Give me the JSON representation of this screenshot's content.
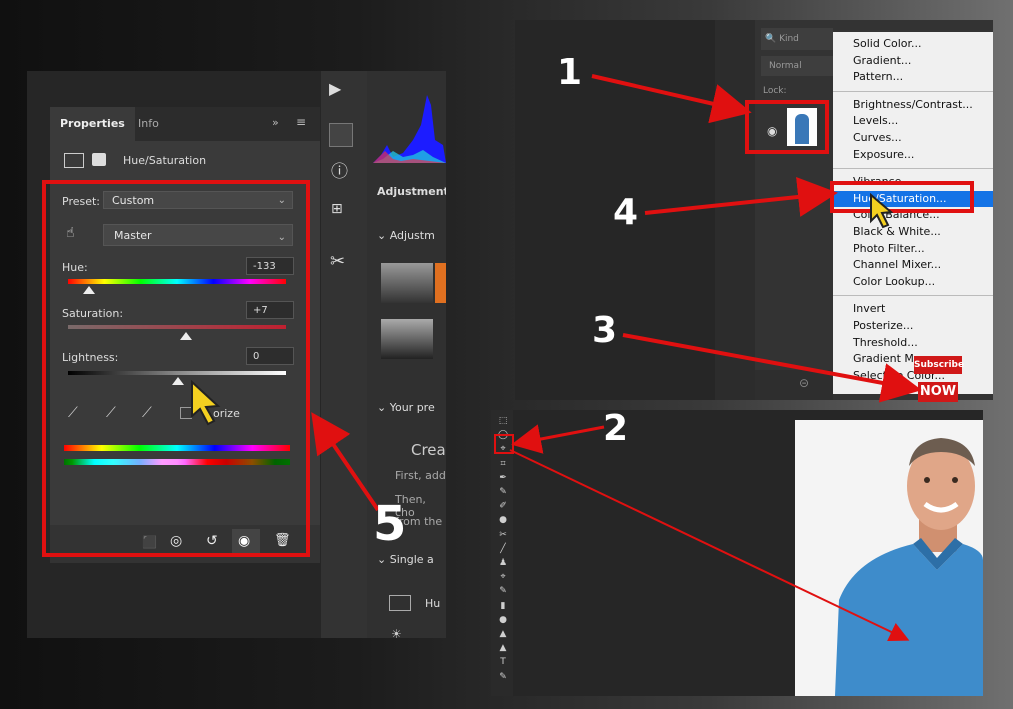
{
  "properties_panel": {
    "tabs": [
      "Properties",
      "Info"
    ],
    "title": "Hue/Saturation",
    "preset_label": "Preset:",
    "preset_value": "Custom",
    "channel_value": "Master",
    "hue_label": "Hue:",
    "hue_value": "-133",
    "saturation_label": "Saturation:",
    "saturation_value": "+7",
    "lightness_label": "Lightness:",
    "lightness_value": "0",
    "colorize_label": "orize"
  },
  "adjustments_panel": {
    "header": "Adjustments",
    "section_adjustments": "Adjustm",
    "section_presets": "Your pre",
    "create_text": "Crea",
    "line1": "First, add",
    "line2": "Then, cho",
    "line3": "from the",
    "section_single": "Single a",
    "hue_item": "Hu"
  },
  "layers_panel": {
    "search_placeholder": "Kind",
    "blend_mode": "Normal",
    "lock_label": "Lock:"
  },
  "adjustment_menu": {
    "groups": [
      [
        "Solid Color...",
        "Gradient...",
        "Pattern..."
      ],
      [
        "Brightness/Contrast...",
        "Levels...",
        "Curves...",
        "Exposure..."
      ],
      [
        "Vibrance...",
        "Hue/Saturation...",
        "Color Balance...",
        "Black & White...",
        "Photo Filter...",
        "Channel Mixer...",
        "Color Lookup..."
      ],
      [
        "Invert",
        "Posterize...",
        "Threshold...",
        "Gradient Map...",
        "Selective Color..."
      ]
    ],
    "highlighted": "Hue/Saturation...",
    "visible_labels": {
      "color_balance": "Color Balance...",
      "black_white": "Black & White...",
      "selective_color": "Selective Co"
    }
  },
  "subscribe_badge": {
    "line1": "Subscribe",
    "line2": "NOW"
  },
  "step_numbers": [
    "1",
    "2",
    "3",
    "4",
    "5"
  ],
  "colors": {
    "annotation_red": "#e01010",
    "menu_highlight": "#1473e6"
  }
}
